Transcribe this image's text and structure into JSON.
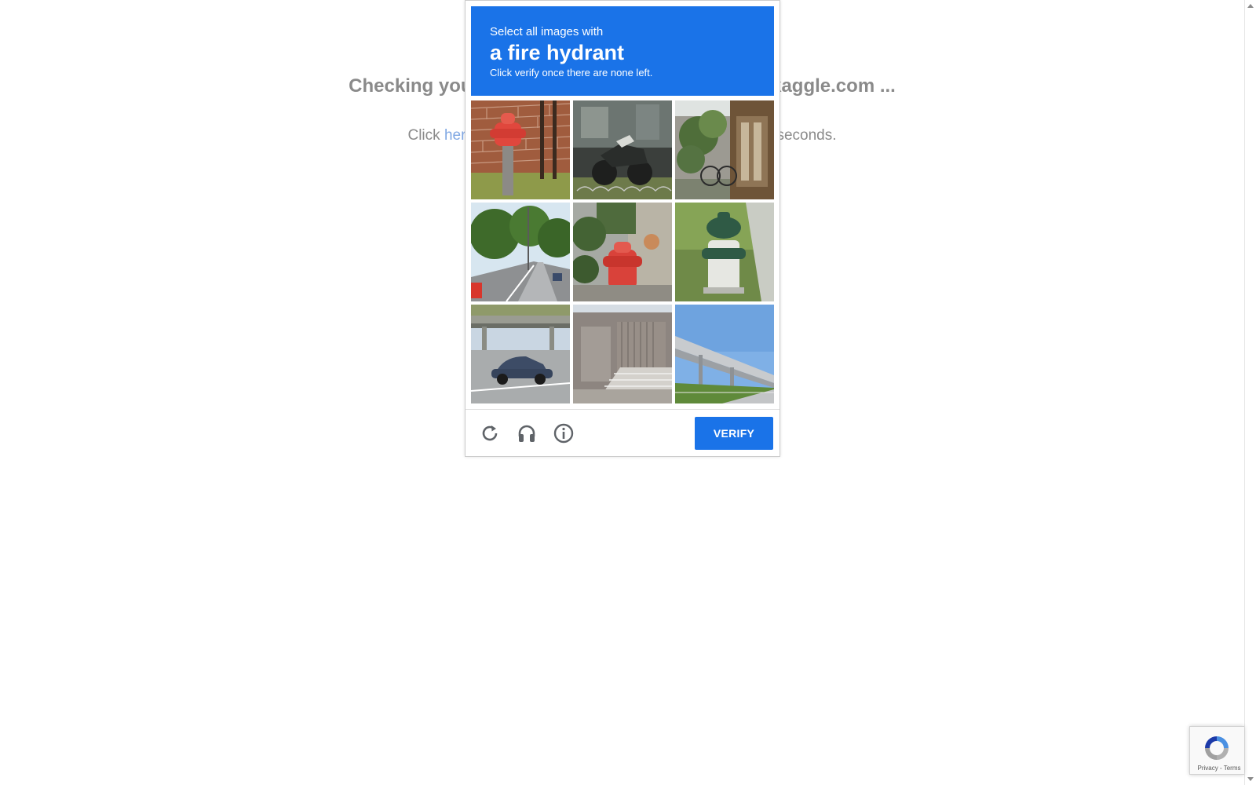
{
  "background": {
    "title": "Checking your browser before accessing www.kaggle.com ...",
    "line_prefix": "Click ",
    "line_link": "here",
    "line_suffix": " if you are not automatically redirected after 5 seconds."
  },
  "captcha": {
    "header": {
      "line1": "Select all images with",
      "line2": "a fire hydrant",
      "line3": "Click verify once there are none left."
    },
    "tiles": [
      {
        "content": "red fire hydrant by brick wall"
      },
      {
        "content": "motorcycle behind glass"
      },
      {
        "content": "alley with plants and bicycle"
      },
      {
        "content": "tree-lined street with cars"
      },
      {
        "content": "red fire hydrant among plants"
      },
      {
        "content": "green and white fire hydrant on grass"
      },
      {
        "content": "car on road under overpass"
      },
      {
        "content": "building with stairs"
      },
      {
        "content": "highway bridge"
      }
    ],
    "footer": {
      "reload_icon": "reload-icon",
      "audio_icon": "headphones-icon",
      "info_icon": "info-icon",
      "verify_label": "VERIFY"
    },
    "accent_color": "#1a73e8"
  },
  "badge": {
    "text": "Privacy - Terms"
  }
}
